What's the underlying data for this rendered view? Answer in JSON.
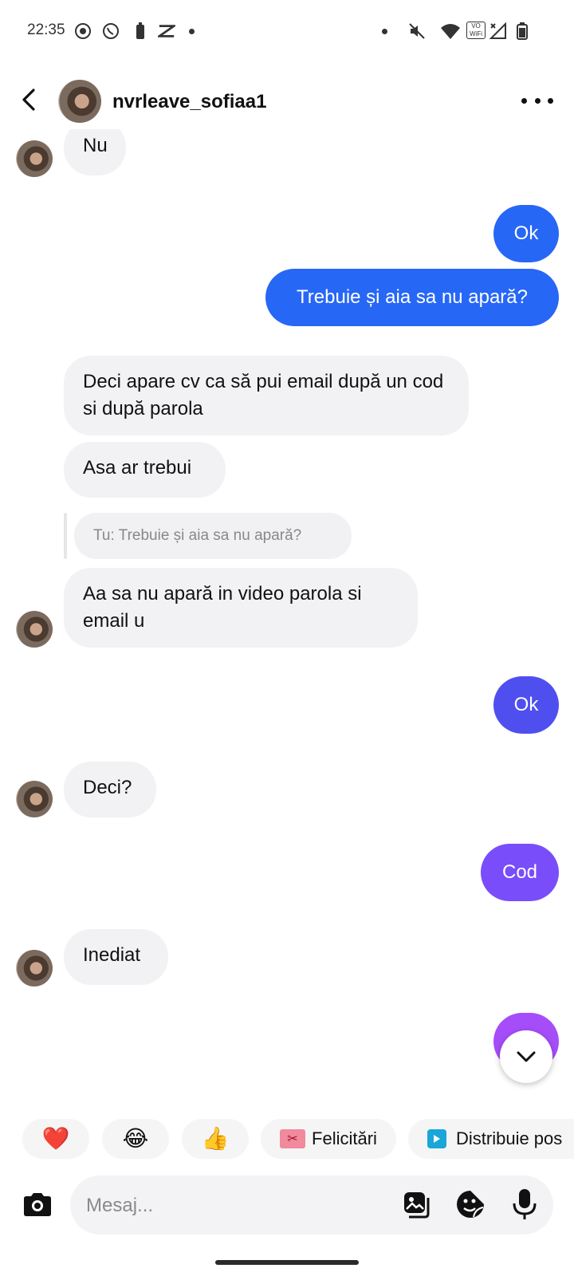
{
  "status_bar": {
    "time": "22:35"
  },
  "header": {
    "username": "nvrleave_sofiaa1"
  },
  "messages": [
    {
      "from": "them",
      "text": "Nu"
    },
    {
      "from": "me",
      "text": "Ok"
    },
    {
      "from": "me",
      "text": "Trebuie și aia sa nu apară?"
    },
    {
      "from": "them",
      "text": "Deci apare cv ca să pui email după un cod si după parola"
    },
    {
      "from": "them",
      "text": "Asa ar trebui"
    },
    {
      "from": "them",
      "reply_to": "Tu: Trebuie și aia sa nu apară?",
      "text": "Aa sa nu apară in video parola si email u"
    },
    {
      "from": "me",
      "text": "Ok"
    },
    {
      "from": "them",
      "text": "Deci?"
    },
    {
      "from": "me",
      "text": "Cod"
    },
    {
      "from": "them",
      "text": "Inediat"
    }
  ],
  "quick_replies": {
    "heart": "❤️",
    "laugh": "😂",
    "thumbs": "👍",
    "congrats": "Felicitări",
    "share": "Distribuie pos"
  },
  "composer": {
    "placeholder": "Mesaj..."
  },
  "colors": {
    "bubble_out_1": "#2767f6",
    "bubble_out_2": "#4f4ff0",
    "bubble_out_3": "#7a4dfa",
    "bubble_out_4": "#a64dfa",
    "bubble_in": "#f2f2f4"
  }
}
